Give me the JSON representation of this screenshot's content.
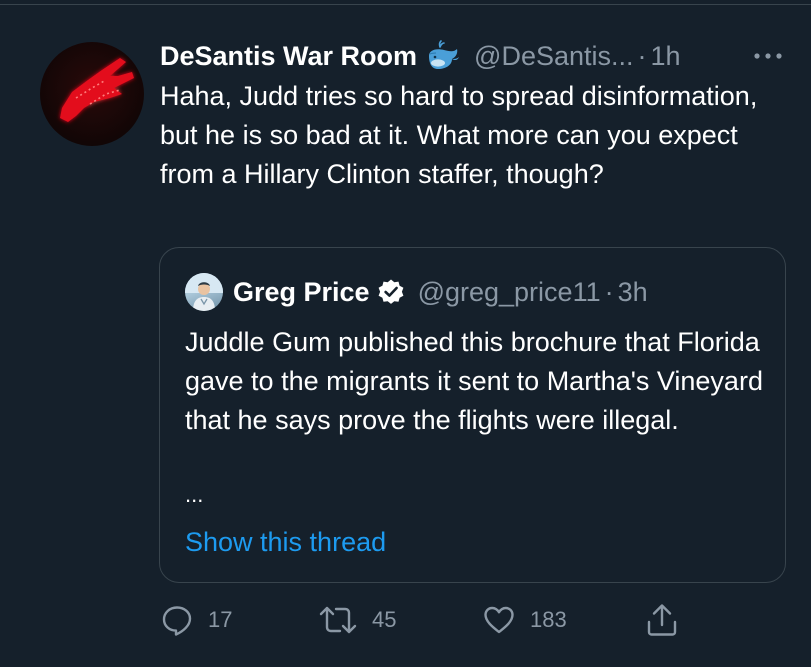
{
  "tweet": {
    "author_name": "DeSantis War Room",
    "author_handle": "@DeSantis...",
    "separator": "·",
    "time": "1h",
    "text": "Haha, Judd tries so hard to spread disinformation, but he is so bad at it. What more can you expect from a Hillary Clinton staffer, though?"
  },
  "quote": {
    "author_name": "Greg Price",
    "author_handle": "@greg_price11",
    "separator": "·",
    "time": "3h",
    "text": "Juddle Gum published this brochure that Florida gave to the migrants it sent to Martha's Vineyard that he says prove the flights were illegal.",
    "ellipsis": "...",
    "show_thread_label": "Show this thread"
  },
  "actions": {
    "reply_count": "17",
    "retweet_count": "45",
    "like_count": "183"
  },
  "colors": {
    "background": "#15202b",
    "text_primary": "#ffffff",
    "text_secondary": "#8b98a5",
    "link": "#1d9bf0",
    "border": "#38444d"
  },
  "icons": [
    "whale-icon",
    "verified-icon",
    "more-icon",
    "reply-icon",
    "retweet-icon",
    "like-icon",
    "share-icon"
  ]
}
